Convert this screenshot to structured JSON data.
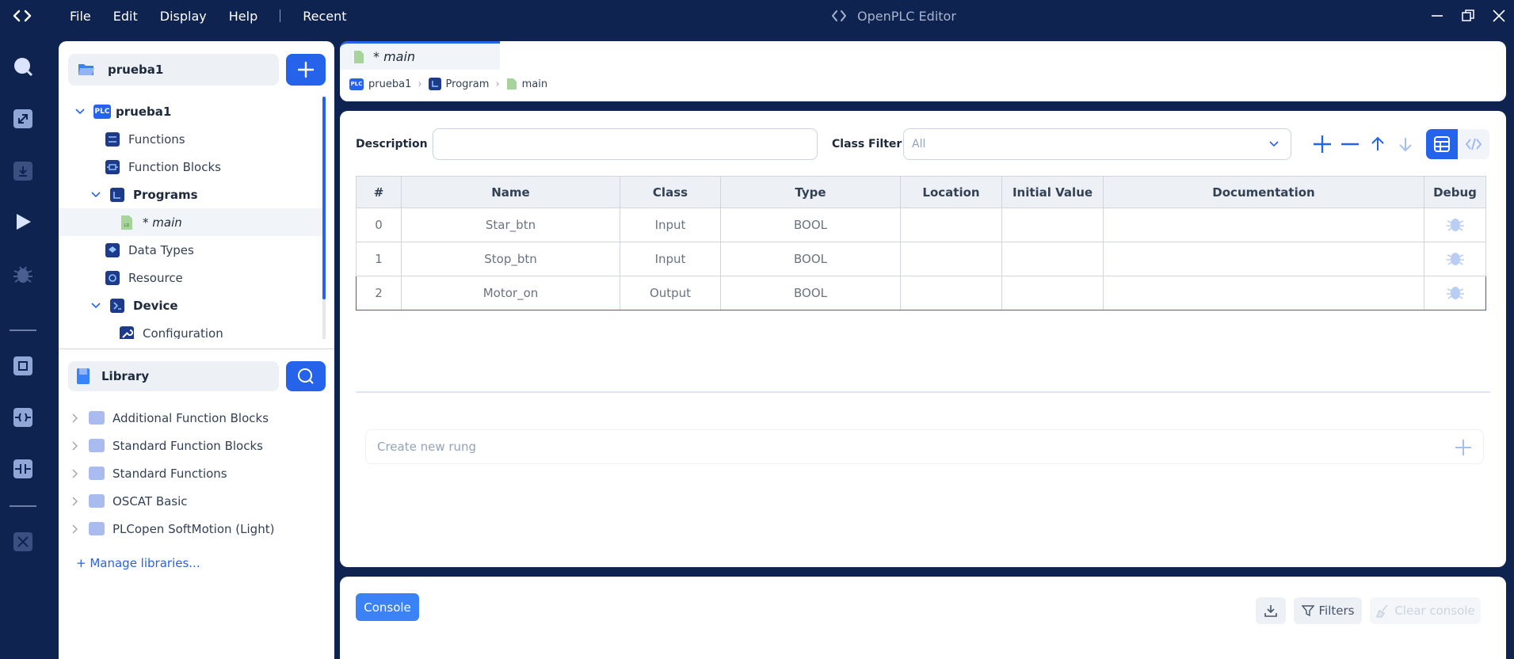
{
  "window": {
    "title": "OpenPLC Editor"
  },
  "menu": {
    "file": "File",
    "edit": "Edit",
    "display": "Display",
    "help": "Help",
    "recent": "Recent"
  },
  "explorer": {
    "project_name": "prueba1",
    "tree": [
      {
        "label": "prueba1",
        "icon": "plc-icon",
        "expanded": true
      },
      {
        "label": "Functions",
        "icon": "functions-icon"
      },
      {
        "label": "Function Blocks",
        "icon": "function-blocks-icon"
      },
      {
        "label": "Programs",
        "icon": "programs-icon",
        "expanded": true
      },
      {
        "label": "* main",
        "icon": "ld-file-icon",
        "selected": true
      },
      {
        "label": "Data Types",
        "icon": "data-types-icon"
      },
      {
        "label": "Resource",
        "icon": "resource-icon"
      },
      {
        "label": "Device",
        "icon": "device-icon",
        "expanded": true
      },
      {
        "label": "Configuration",
        "icon": "wrench-icon"
      }
    ],
    "plc_badge": "PLC"
  },
  "library": {
    "title": "Library",
    "items": [
      "Additional Function Blocks",
      "Standard Function Blocks",
      "Standard Functions",
      "OSCAT Basic",
      "PLCopen SoftMotion (Light)"
    ],
    "manage_link": "+ Manage libraries..."
  },
  "editor": {
    "tab_label": "* main",
    "breadcrumb": [
      "prueba1",
      "Program",
      "main"
    ],
    "description_label": "Description :",
    "description_value": "",
    "class_filter_label": "Class Filter :",
    "class_filter_value": "All",
    "table": {
      "columns": [
        "#",
        "Name",
        "Class",
        "Type",
        "Location",
        "Initial Value",
        "Documentation",
        "Debug"
      ],
      "rows": [
        {
          "index": "0",
          "name": "Star_btn",
          "class": "Input",
          "type": "BOOL",
          "location": "",
          "initial": "",
          "doc": ""
        },
        {
          "index": "1",
          "name": "Stop_btn",
          "class": "Input",
          "type": "BOOL",
          "location": "",
          "initial": "",
          "doc": ""
        },
        {
          "index": "2",
          "name": "Motor_on",
          "class": "Output",
          "type": "BOOL",
          "location": "",
          "initial": "",
          "doc": ""
        }
      ]
    },
    "rung_placeholder": "Create new rung"
  },
  "console": {
    "tab": "Console",
    "filters": "Filters",
    "clear": "Clear console"
  },
  "colors": {
    "accent": "#2563eb",
    "titlebar": "#0f2350"
  }
}
